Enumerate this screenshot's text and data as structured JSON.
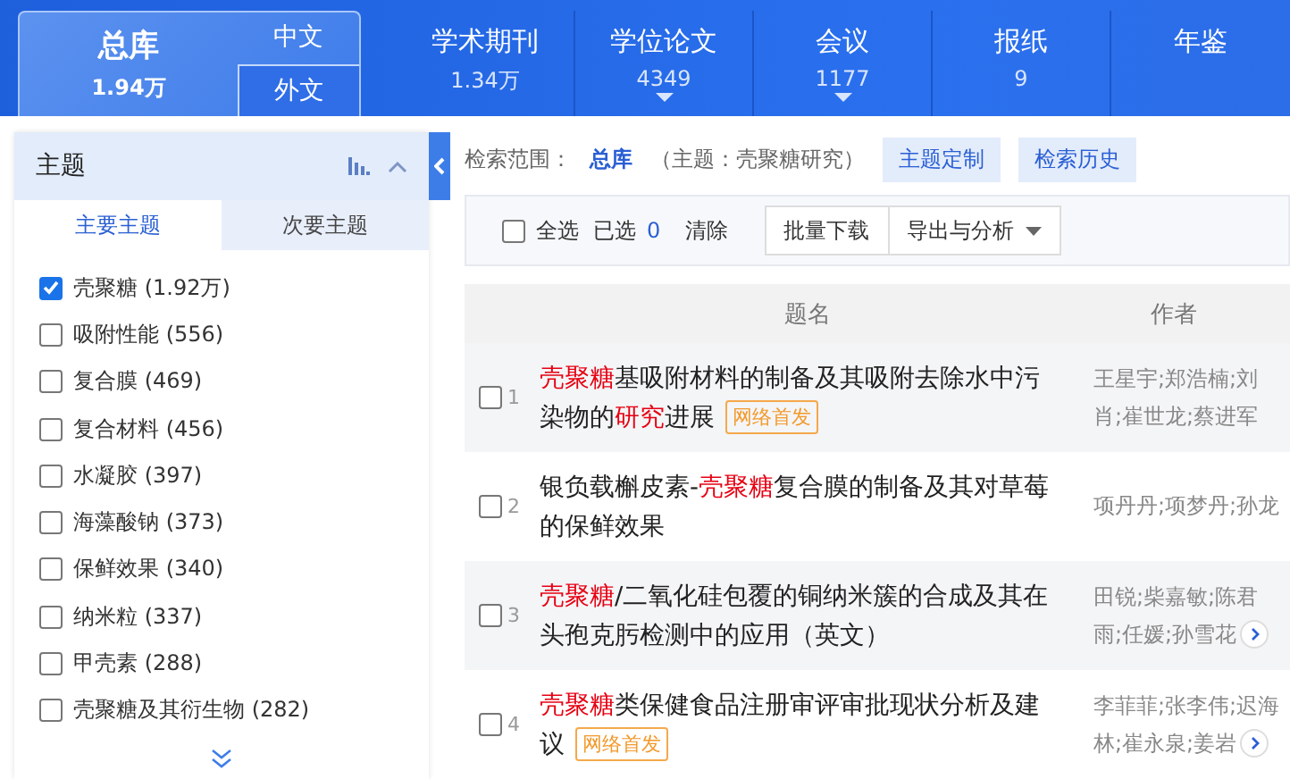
{
  "header": {
    "main": {
      "name": "总库",
      "count": "1.94万"
    },
    "lang_tabs": [
      "中文",
      "外文"
    ],
    "categories": [
      {
        "name": "学术期刊",
        "count": "1.34万",
        "caret": false
      },
      {
        "name": "学位论文",
        "count": "4349",
        "caret": true
      },
      {
        "name": "会议",
        "count": "1177",
        "caret": true
      },
      {
        "name": "报纸",
        "count": "9",
        "caret": false
      },
      {
        "name": "年鉴",
        "caret": false
      }
    ]
  },
  "sidebar": {
    "title": "主题",
    "tabs": [
      {
        "label": "主要主题",
        "selected": true
      },
      {
        "label": "次要主题",
        "selected": false
      }
    ],
    "items": [
      {
        "label": "壳聚糖",
        "count": "(1.92万)",
        "checked": true
      },
      {
        "label": "吸附性能",
        "count": "(556)",
        "checked": false
      },
      {
        "label": "复合膜",
        "count": "(469)",
        "checked": false
      },
      {
        "label": "复合材料",
        "count": "(456)",
        "checked": false
      },
      {
        "label": "水凝胶",
        "count": "(397)",
        "checked": false
      },
      {
        "label": "海藻酸钠",
        "count": "(373)",
        "checked": false
      },
      {
        "label": "保鲜效果",
        "count": "(340)",
        "checked": false
      },
      {
        "label": "纳米粒",
        "count": "(337)",
        "checked": false
      },
      {
        "label": "甲壳素",
        "count": "(288)",
        "checked": false
      },
      {
        "label": "壳聚糖及其衍生物",
        "count": "(282)",
        "checked": false
      }
    ]
  },
  "search_scope": {
    "label": "检索范围：",
    "scope": "总库",
    "query": "（主题：壳聚糖研究）",
    "buttons": [
      "主题定制",
      "检索历史"
    ]
  },
  "toolbar": {
    "select_all": {
      "label": "全选",
      "checked": false
    },
    "selected_label": "已选",
    "selected_count": "0",
    "clear": "清除",
    "buttons": [
      {
        "label": "批量下载",
        "caret": false
      },
      {
        "label": "导出与分析",
        "caret": true
      }
    ]
  },
  "table": {
    "columns": [
      "题名",
      "作者"
    ],
    "rows": [
      {
        "number": "1",
        "checked": false,
        "title": [
          {
            "text": "壳聚糖",
            "highlight": true
          },
          {
            "text": "基吸附材料的制备及其吸附去除水中污染物的",
            "highlight": false
          },
          {
            "text": "研究",
            "highlight": true
          },
          {
            "text": "进展",
            "highlight": false
          }
        ],
        "tag": "网络首发",
        "authors": [
          "王星宇;郑浩楠;刘",
          "肖;崔世龙;蔡进军"
        ],
        "more": false
      },
      {
        "number": "2",
        "checked": false,
        "title": [
          {
            "text": "银负载槲皮素-",
            "highlight": false
          },
          {
            "text": "壳聚糖",
            "highlight": true
          },
          {
            "text": "复合膜的制备及其对草莓的保鲜效果",
            "highlight": false
          }
        ],
        "authors": [
          "项丹丹;项梦丹;孙龙"
        ],
        "more": false
      },
      {
        "number": "3",
        "checked": false,
        "title": [
          {
            "text": "壳聚糖",
            "highlight": true
          },
          {
            "text": "/二氧化硅包覆的铜纳米簇的合成及其在头孢克肟检测中的应用（英文）",
            "highlight": false
          }
        ],
        "authors": [
          "田锐;柴嘉敏;陈君",
          "雨;任媛;孙雪花"
        ],
        "more": true
      },
      {
        "number": "4",
        "checked": false,
        "title": [
          {
            "text": "壳聚糖",
            "highlight": true
          },
          {
            "text": "类保健食品注册审评审批现状分析及建议",
            "highlight": false
          }
        ],
        "tag": "网络首发",
        "authors": [
          "李菲菲;张李伟;迟海",
          "林;崔永泉;姜岩"
        ],
        "more": true
      }
    ]
  }
}
